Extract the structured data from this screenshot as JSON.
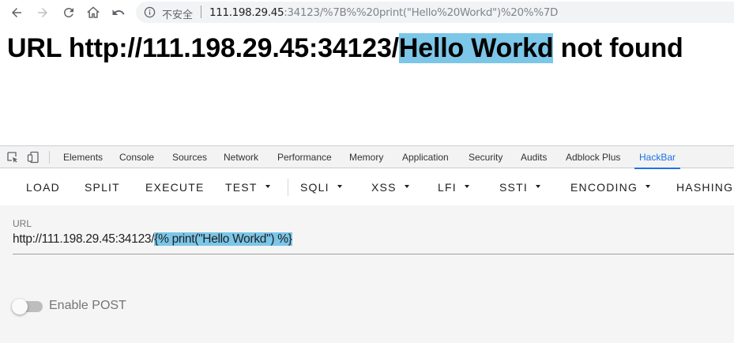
{
  "browser": {
    "nav": [
      "back-icon",
      "forward-icon",
      "reload-icon",
      "home-icon",
      "undo-icon"
    ],
    "security_label": "不安全",
    "url_host": "111.198.29.45",
    "url_path": ":34123/%7B%%20print(\"Hello%20Workd\")%20%%7D"
  },
  "page": {
    "heading_prefix": "URL http://111.198.29.45:34123/",
    "heading_highlight": "Hello Workd",
    "heading_suffix": " not found"
  },
  "devtools": {
    "tabs": [
      "Elements",
      "Console",
      "Sources",
      "Network",
      "Performance",
      "Memory",
      "Application",
      "Security",
      "Audits",
      "Adblock Plus",
      "HackBar"
    ],
    "active_tab": "HackBar",
    "accent": "#1a73e8"
  },
  "hackbar": {
    "buttons": [
      "LOAD",
      "SPLIT",
      "EXECUTE",
      "TEST",
      "SQLI",
      "XSS",
      "LFI",
      "SSTI",
      "ENCODING",
      "HASHING"
    ],
    "url_label": "URL",
    "url_prefix": "http://111.198.29.45:34123/",
    "url_selected": "{% print(\"Hello Workd\") %}",
    "enable_post_label": "Enable POST",
    "enable_post": false,
    "highlight_color": "#7cc6e8"
  }
}
